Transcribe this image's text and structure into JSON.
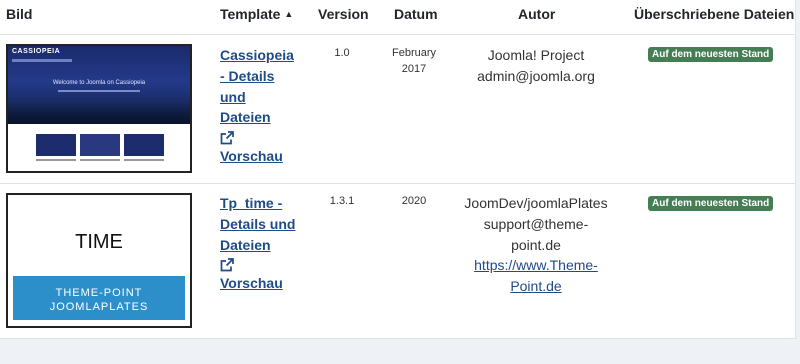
{
  "table": {
    "headers": {
      "image": "Bild",
      "template": "Template",
      "sort_indicator": "▲",
      "version": "Version",
      "date": "Datum",
      "author": "Autor",
      "overrides": "Überschriebene Dateien"
    },
    "rows": [
      {
        "thumbnail": {
          "brand": "CASSIOPEIA",
          "hero_text": "Welcome to Joomla on Cassiopeia"
        },
        "link_lines": [
          "Cassiopeia",
          "- Details",
          "und",
          "Dateien"
        ],
        "preview_label": "Vorschau",
        "version": "1.0",
        "date_lines": [
          "February",
          "2017"
        ],
        "author_lines": [
          "Joomla! Project",
          "admin@joomla.org"
        ],
        "author_link_lines": [],
        "status": "Auf dem neuesten Stand"
      },
      {
        "thumbnail": {
          "title": "TIME",
          "line1": "THEME-POINT",
          "line2": "JOOMLAPLATES"
        },
        "link_lines": [
          "Tp_time -",
          "Details und",
          "Dateien"
        ],
        "preview_label": "Vorschau",
        "version": "1.3.1",
        "date_lines": [
          "2020"
        ],
        "author_lines": [
          "JoomDev/joomlaPlates",
          "support@theme-",
          "point.de"
        ],
        "author_link_lines": [
          "https://www.Theme-",
          "Point.de"
        ],
        "status": "Auf dem neuesten Stand"
      }
    ]
  },
  "colors": {
    "link": "#1f4b86",
    "badge": "#457d54",
    "page_bg": "#eef2f7",
    "thumb_blue": "#2d8fc9"
  }
}
